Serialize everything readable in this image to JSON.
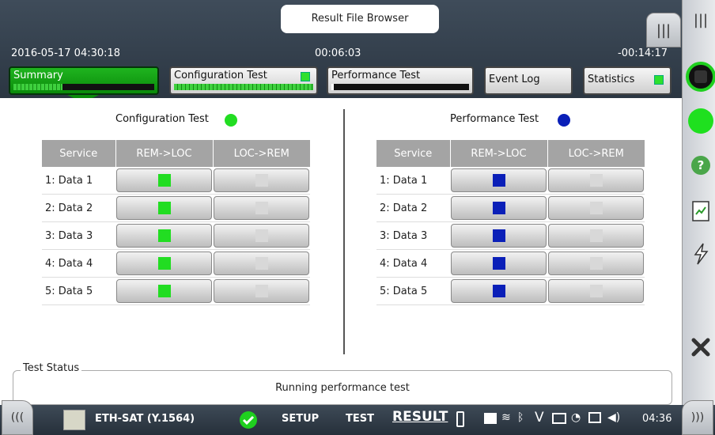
{
  "window": {
    "title": "Result File Browser"
  },
  "header": {
    "datetime": "2016-05-17 04:30:18",
    "elapsed": "00:06:03",
    "remaining": "-00:14:17"
  },
  "tabs": [
    {
      "label": "Summary",
      "progress": 0.35,
      "active": true
    },
    {
      "label": "Configuration Test",
      "progress": 1.0,
      "indicator_color": "#2ee02e"
    },
    {
      "label": "Performance Test",
      "progress": 0.02
    },
    {
      "label": "Event Log"
    },
    {
      "label": "Statistics",
      "indicator_color": "#2ee02e"
    }
  ],
  "config_panel": {
    "title": "Configuration Test",
    "status_color": "#22dd22",
    "columns": [
      "Service",
      "REM->LOC",
      "LOC->REM"
    ],
    "rows": [
      {
        "name": "1: Data 1",
        "rem_loc_color": "#22dd22",
        "loc_rem_color": "#d8d8d8"
      },
      {
        "name": "2: Data 2",
        "rem_loc_color": "#22dd22",
        "loc_rem_color": "#d8d8d8"
      },
      {
        "name": "3: Data 3",
        "rem_loc_color": "#22dd22",
        "loc_rem_color": "#d8d8d8"
      },
      {
        "name": "4: Data 4",
        "rem_loc_color": "#22dd22",
        "loc_rem_color": "#d8d8d8"
      },
      {
        "name": "5: Data 5",
        "rem_loc_color": "#22dd22",
        "loc_rem_color": "#d8d8d8"
      }
    ]
  },
  "perf_panel": {
    "title": "Performance Test",
    "status_color": "#0a1fb8",
    "columns": [
      "Service",
      "REM->LOC",
      "LOC->REM"
    ],
    "rows": [
      {
        "name": "1: Data 1",
        "rem_loc_color": "#0a1fb8",
        "loc_rem_color": "#d8d8d8"
      },
      {
        "name": "2: Data 2",
        "rem_loc_color": "#0a1fb8",
        "loc_rem_color": "#d8d8d8"
      },
      {
        "name": "3: Data 3",
        "rem_loc_color": "#0a1fb8",
        "loc_rem_color": "#d8d8d8"
      },
      {
        "name": "4: Data 4",
        "rem_loc_color": "#0a1fb8",
        "loc_rem_color": "#d8d8d8"
      },
      {
        "name": "5: Data 5",
        "rem_loc_color": "#0a1fb8",
        "loc_rem_color": "#d8d8d8"
      }
    ]
  },
  "test_status": {
    "legend": "Test Status",
    "text": "Running performance test"
  },
  "sidebar": {
    "icons": [
      "stop-icon",
      "status-green-icon",
      "help-icon",
      "report-icon",
      "lightning-icon",
      "close-icon"
    ]
  },
  "bottombar": {
    "app_name": "ETH-SAT (Y.1564)",
    "setup_label": "SETUP",
    "test_label": "TEST",
    "result_label": "RESULT",
    "clock": "04:36"
  }
}
